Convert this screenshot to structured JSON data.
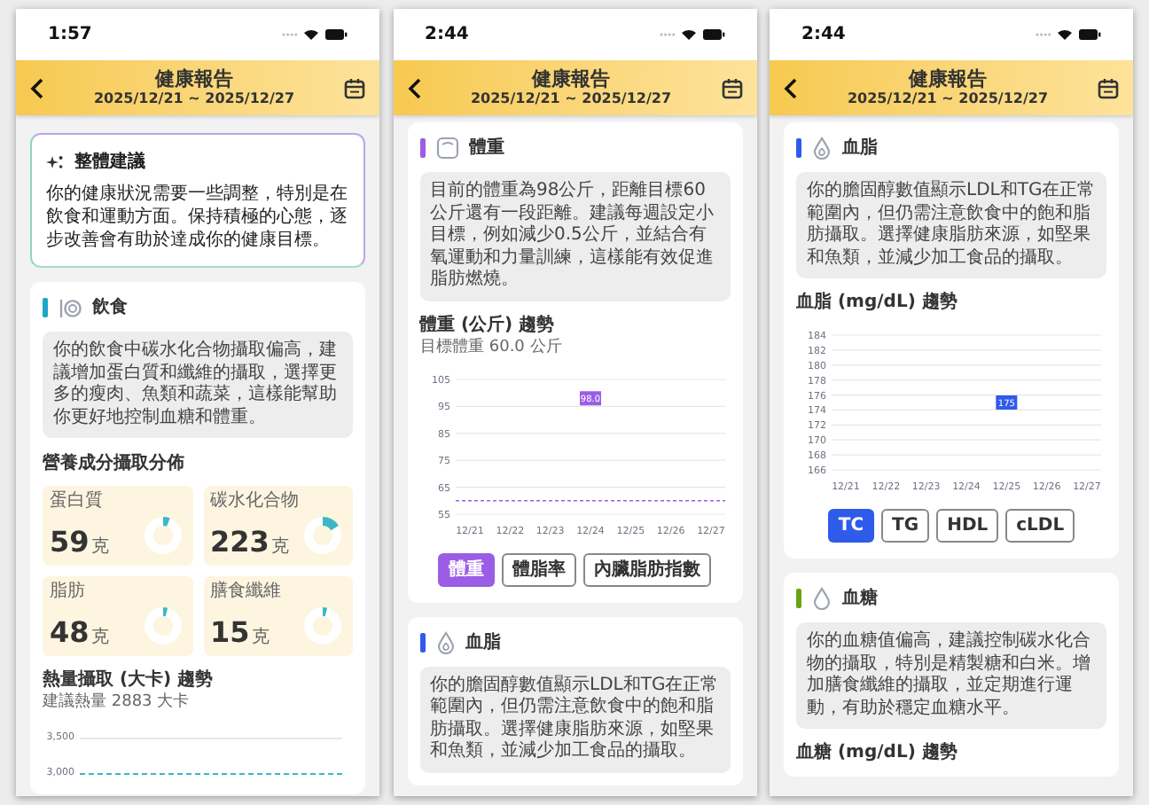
{
  "phones": [
    {
      "status_time": "1:57",
      "header": {
        "title": "健康報告",
        "date_range": "2025/12/21 ~ 2025/12/27"
      },
      "sections": [
        {
          "kind": "summary",
          "title": "整體建議",
          "text": "你的健康狀況需要一些調整，特別是在飲食和運動方面。保持積極的心態，逐步改善會有助於達成你的健康目標。"
        },
        {
          "kind": "diet",
          "title": "飲食",
          "color": "#1ea7c8",
          "advice": "你的飲食中碳水化合物攝取偏高，建議增加蛋白質和纖維的攝取，選擇更多的瘦肉、魚類和蔬菜，這樣能幫助你更好地控制血糖和體重。",
          "subtitle": "營養成分攝取分佈",
          "nutrients": [
            {
              "name": "蛋白質",
              "value": "59",
              "unit": "克",
              "level": 0.06
            },
            {
              "name": "碳水化合物",
              "value": "223",
              "unit": "克",
              "level": 0.16
            },
            {
              "name": "脂肪",
              "value": "48",
              "unit": "克",
              "level": 0.04
            },
            {
              "name": "膳食纖維",
              "value": "15",
              "unit": "克",
              "level": 0.04
            }
          ],
          "chart_title": "熱量攝取 (大卡) 趨勢",
          "chart_note": "建議熱量 2883 大卡",
          "axis_labels": [
            "3,500",
            "3,000"
          ]
        }
      ]
    },
    {
      "status_time": "2:44",
      "header": {
        "title": "健康報告",
        "date_range": "2025/12/21 ~ 2025/12/27"
      },
      "sections": [
        {
          "kind": "weight",
          "title": "體重",
          "color": "#9b5de5",
          "advice": "目前的體重為98公斤，距離目標60公斤還有一段距離。建議每週設定小目標，例如減少0.5公斤，並結合有氧運動和力量訓練，這樣能有效促進脂肪燃燒。",
          "chart_title": "體重 (公斤) 趨勢",
          "chart_note": "目標體重 60.0 公斤",
          "chart_data": {
            "type": "line",
            "categories": [
              "12/21",
              "12/22",
              "12/23",
              "12/24",
              "12/25",
              "12/26",
              "12/27"
            ],
            "series": [
              {
                "color": "#9b5de5",
                "marker": "square",
                "values": [
                  null,
                  null,
                  null,
                  98.0,
                  null,
                  null,
                  null
                ]
              }
            ],
            "ylim": [
              55,
              105
            ],
            "yticks": [
              55,
              65,
              75,
              85,
              95,
              105
            ],
            "grid": true,
            "value_labels": [
              null,
              null,
              null,
              "98.0",
              null,
              null,
              null
            ],
            "ref_lines": [
              {
                "axis": "y",
                "value": 60
              }
            ]
          },
          "toggles": [
            {
              "label": "體重",
              "selected": true
            },
            {
              "label": "體脂率",
              "selected": false
            },
            {
              "label": "內臟脂肪指數",
              "selected": false
            }
          ]
        },
        {
          "kind": "lipid",
          "title": "血脂",
          "color": "#2f5bea",
          "advice": "你的膽固醇數值顯示LDL和TG在正常範圍內，但仍需注意飲食中的飽和脂肪攝取。選擇健康脂肪來源，如堅果和魚類，並減少加工食品的攝取。"
        }
      ]
    },
    {
      "status_time": "2:44",
      "header": {
        "title": "健康報告",
        "date_range": "2025/12/21 ~ 2025/12/27"
      },
      "sections": [
        {
          "kind": "lipid",
          "title": "血脂",
          "color": "#2f5bea",
          "advice": "你的膽固醇數值顯示LDL和TG在正常範圍內，但仍需注意飲食中的飽和脂肪攝取。選擇健康脂肪來源，如堅果和魚類，並減少加工食品的攝取。",
          "chart_title": "血脂 (mg/dL) 趨勢",
          "chart_data": {
            "type": "line",
            "categories": [
              "12/21",
              "12/22",
              "12/23",
              "12/24",
              "12/25",
              "12/26",
              "12/27"
            ],
            "series": [
              {
                "color": "#2f5bea",
                "marker": "square",
                "values": [
                  null,
                  null,
                  null,
                  null,
                  175,
                  null,
                  null
                ]
              }
            ],
            "ylim": [
              166,
              184
            ],
            "yticks": [
              166,
              168,
              170,
              172,
              174,
              176,
              178,
              180,
              182,
              184
            ],
            "grid": true,
            "value_labels": [
              null,
              null,
              null,
              null,
              "175",
              null,
              null
            ]
          },
          "toggles": [
            {
              "label": "TC",
              "selected": true
            },
            {
              "label": "TG",
              "selected": false
            },
            {
              "label": "HDL",
              "selected": false
            },
            {
              "label": "cLDL",
              "selected": false
            }
          ]
        },
        {
          "kind": "glucose",
          "title": "血糖",
          "color": "#6aa312",
          "advice": "你的血糖值偏高，建議控制碳水化合物的攝取，特別是精製糖和白米。增加膳食纖維的攝取，並定期進行運動，有助於穩定血糖水平。",
          "chart_title": "血糖 (mg/dL) 趨勢"
        }
      ]
    }
  ]
}
